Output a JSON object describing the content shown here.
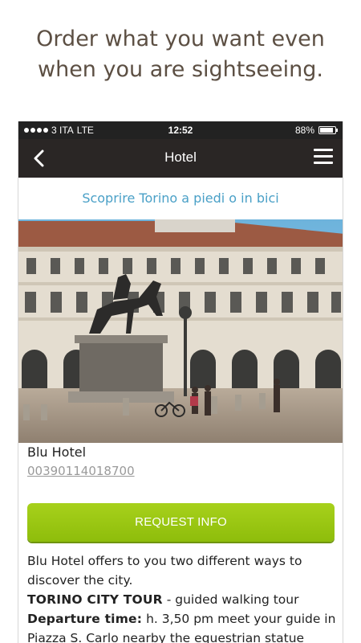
{
  "promo": {
    "line1": "Order what you want even",
    "line2": "when you are sightseeing."
  },
  "status_bar": {
    "carrier": "3 ITA",
    "network": "LTE",
    "time": "12:52",
    "battery_text": "88%",
    "battery_level": 0.88
  },
  "nav": {
    "back_icon": "chevron-left-icon",
    "title": "Hotel",
    "menu_icon": "hamburger-menu-icon"
  },
  "subtitle": "Scoprire Torino a piedi o in bici",
  "hotel": {
    "name": "Blu Hotel",
    "phone": "00390114018700"
  },
  "request_button": "REQUEST INFO",
  "description": {
    "intro": "Blu Hotel offers to you two different ways to discover the city.",
    "tour_name": "TORINO CITY TOUR",
    "tour_detail": " - guided walking tour",
    "departure_label": "Departure time:",
    "departure_text": " h. 3,50 pm meet your guide in Piazza S. Carlo nearby the equestrian statue"
  },
  "colors": {
    "promo_text": "#5c4f43",
    "navbar": "#2a2625",
    "subtitle": "#4aa0c7",
    "button": "#9ac712"
  }
}
